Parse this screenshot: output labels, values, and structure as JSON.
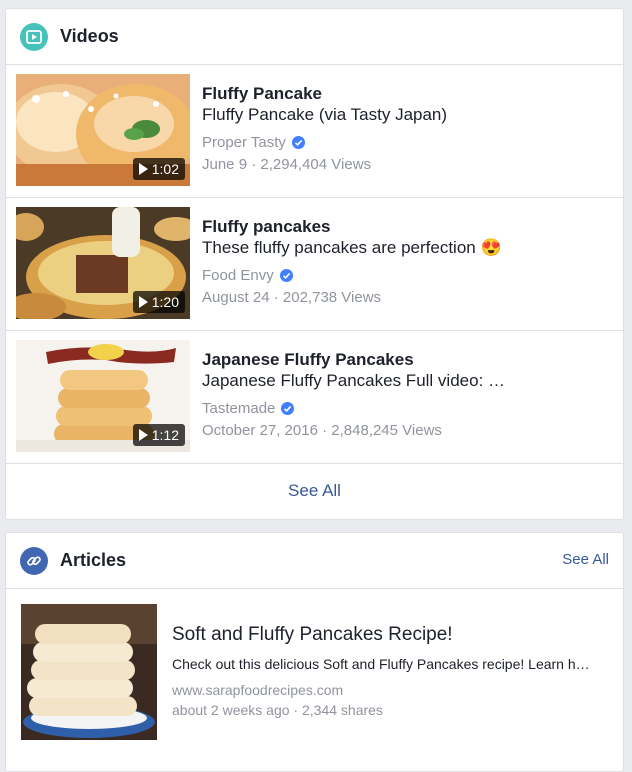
{
  "videos": {
    "title": "Videos",
    "icon": "video-play-icon",
    "items": [
      {
        "title": "Fluffy Pancake",
        "description": "Fluffy Pancake (via Tasty Japan)",
        "channel": "Proper Tasty",
        "date": "June 9",
        "views": "2,294,404 Views",
        "duration": "1:02"
      },
      {
        "title": "Fluffy pancakes",
        "description": "These fluffy pancakes are perfection",
        "emoji": "😍",
        "channel": "Food Envy",
        "date": "August 24",
        "views": "202,738 Views",
        "duration": "1:20"
      },
      {
        "title": "Japanese Fluffy Pancakes",
        "description": "Japanese Fluffy Pancakes Full video: https://www.youtube.com/watch",
        "channel": "Tastemade",
        "date": "October 27, 2016",
        "views": "2,848,245 Views",
        "duration": "1:12"
      }
    ],
    "see_all_label": "See All",
    "separator": " · "
  },
  "articles": {
    "title": "Articles",
    "icon": "link-icon",
    "see_all_label": "See All",
    "item": {
      "title": "Soft and Fluffy Pancakes Recipe!",
      "description": "Check out this delicious Soft and Fluffy Pancakes recipe! Learn how to make them at home",
      "domain": "www.sarapfoodrecipes.com",
      "time": "about 2 weeks ago",
      "shares": "2,344 shares"
    }
  },
  "colors": {
    "accent_link": "#385898",
    "video_icon_bg": "#47c2ba",
    "article_icon_bg": "#4267b2",
    "verified_badge": "#4080ff",
    "muted_text": "#90949c"
  }
}
